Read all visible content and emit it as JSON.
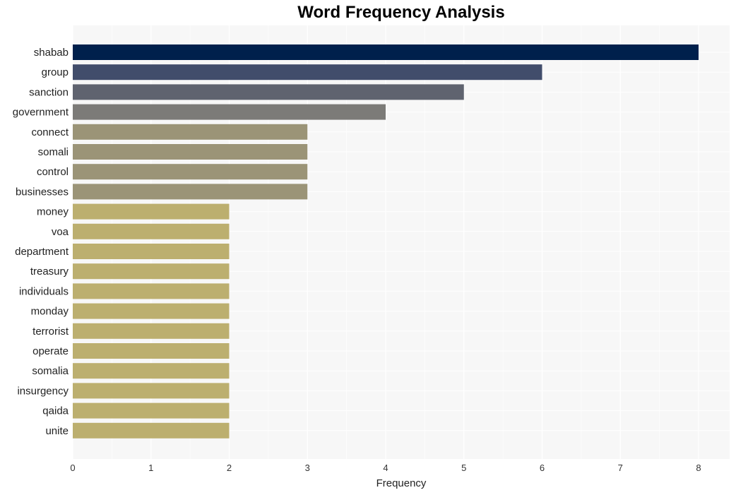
{
  "chart_data": {
    "type": "bar",
    "orientation": "horizontal",
    "title": "Word Frequency Analysis",
    "xlabel": "Frequency",
    "ylabel": "",
    "xlim": [
      0,
      8.4
    ],
    "xticks": [
      0,
      1,
      2,
      3,
      4,
      5,
      6,
      7,
      8
    ],
    "grid": true,
    "categories": [
      "shabab",
      "group",
      "sanction",
      "government",
      "connect",
      "somali",
      "control",
      "businesses",
      "money",
      "voa",
      "department",
      "treasury",
      "individuals",
      "monday",
      "terrorist",
      "operate",
      "somalia",
      "insurgency",
      "qaida",
      "unite"
    ],
    "values": [
      8,
      6,
      5,
      4,
      3,
      3,
      3,
      3,
      2,
      2,
      2,
      2,
      2,
      2,
      2,
      2,
      2,
      2,
      2,
      2
    ],
    "colors": [
      "#00204c",
      "#414d6b",
      "#5f636f",
      "#7c7b78",
      "#9b9477",
      "#9b9477",
      "#9b9477",
      "#9b9477",
      "#bcaf6f",
      "#bcaf6f",
      "#bcaf6f",
      "#bcaf6f",
      "#bcaf6f",
      "#bcaf6f",
      "#bcaf6f",
      "#bcaf6f",
      "#bcaf6f",
      "#bcaf6f",
      "#bcaf6f",
      "#bcaf6f"
    ]
  }
}
